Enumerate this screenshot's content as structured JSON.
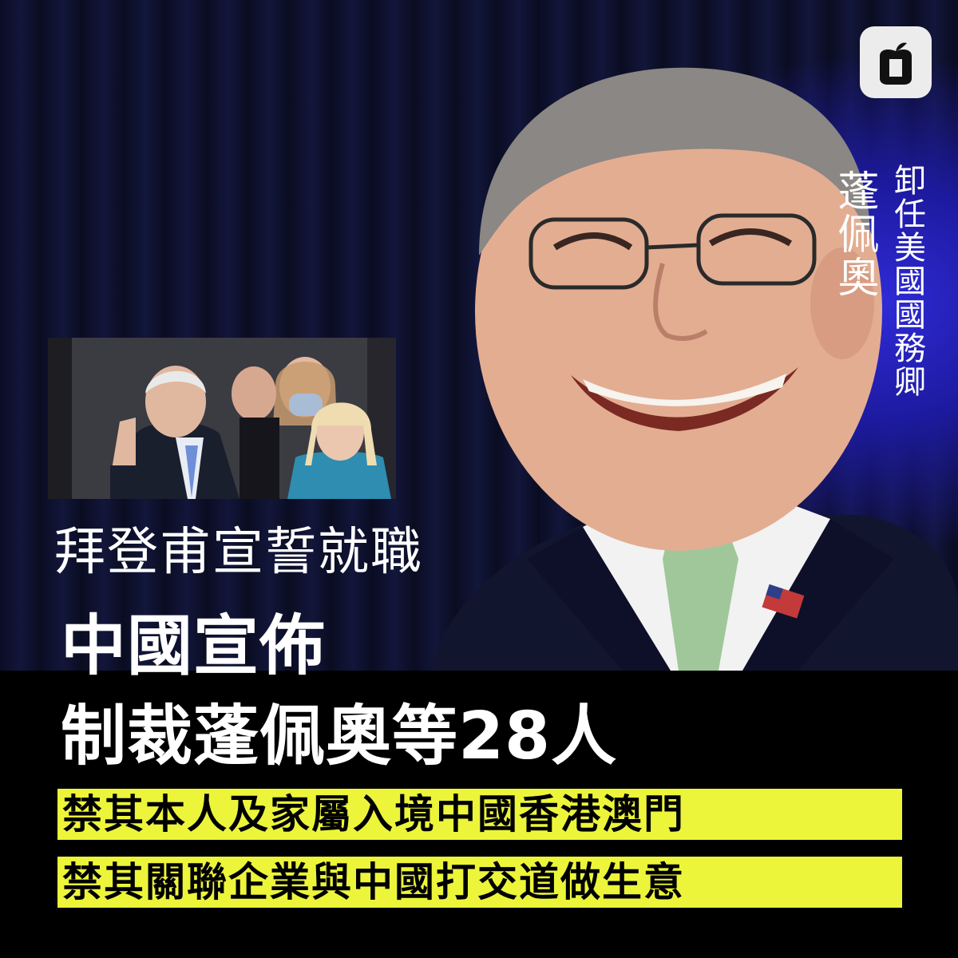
{
  "logo": {
    "icon": "apple-logo-icon",
    "bg": "#ececec"
  },
  "vertical_name": "蓬佩奧",
  "vertical_title": "卸任美國國務卿",
  "headline_1": "拜登甫宣誓就職",
  "headline_2": "中國宣佈",
  "headline_3": "制裁蓬佩奧等28人",
  "highlight_1": "禁其本人及家屬入境中國香港澳門",
  "highlight_2": "禁其關聯企業與中國打交道做生意",
  "colors": {
    "highlight": "#ecf53a",
    "band": "#000000",
    "stage_blue": "#2f2bd8"
  }
}
